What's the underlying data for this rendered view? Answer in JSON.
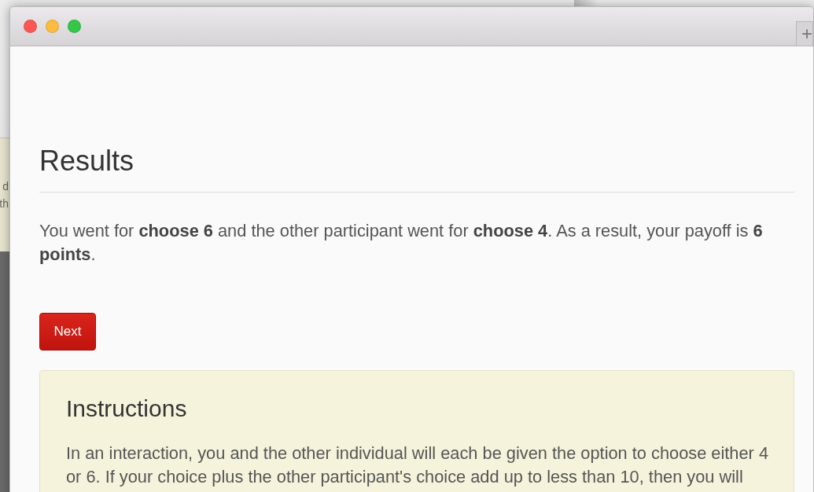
{
  "back_window": {
    "lines": [
      "d",
      "th"
    ]
  },
  "window": {
    "controls": [
      {
        "color": "#fc5753"
      },
      {
        "color": "#fdbc40"
      },
      {
        "color": "#33c748"
      }
    ],
    "new_tab": "+"
  },
  "results": {
    "title": "Results",
    "message": "You went for **choose 6** and the other participant went for **choose 4**. As a result, your payoff is **6 points**.",
    "next_button": "Next"
  },
  "instructions": {
    "title": "Instructions",
    "text": "In an interaction, you and the other individual will each be given the option to choose either 4 or 6. If your choice plus the other participant's choice add up to less than 10, then you will"
  }
}
